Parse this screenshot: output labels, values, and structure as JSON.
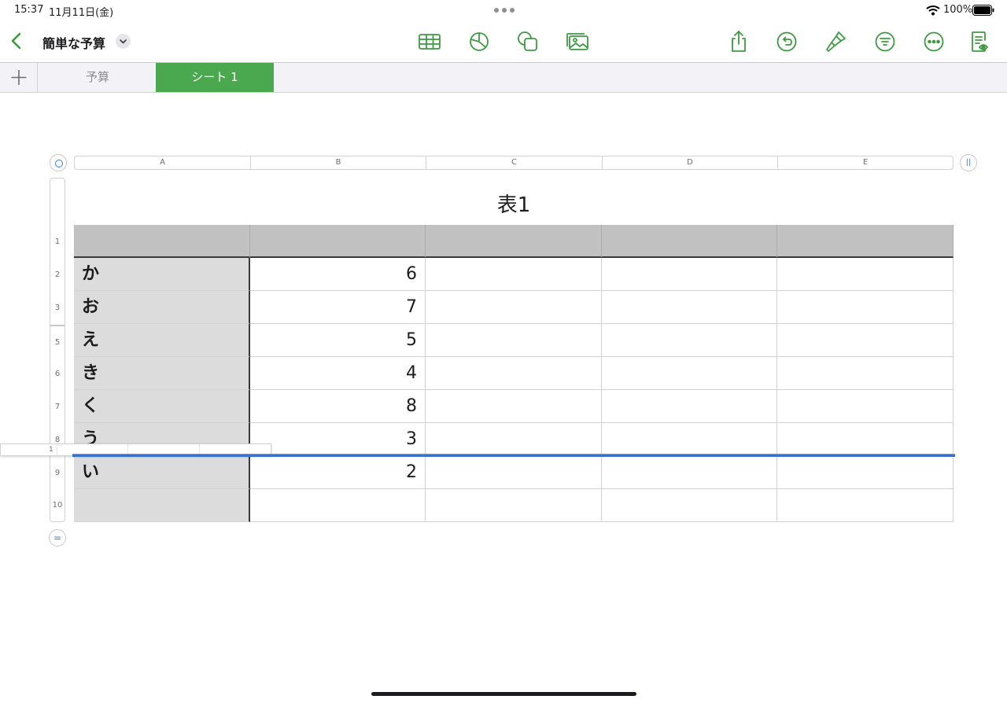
{
  "status_bar": {
    "time": "15:37",
    "date": "11月11日(金)",
    "battery": "100%"
  },
  "toolbar": {
    "doc_title": "簡単な予算",
    "icons": [
      "table-icon",
      "chart-icon",
      "shape-icon",
      "media-icon",
      "share-icon",
      "undo-icon",
      "format-brush-icon",
      "organize-icon",
      "more-icon",
      "reader-view-icon"
    ],
    "accent_color": "#3d9a41"
  },
  "sheets": {
    "tabs": [
      {
        "label": "予算",
        "active": false
      },
      {
        "label": "シート 1",
        "active": true
      }
    ],
    "active_color": "#4aa84f"
  },
  "table": {
    "title": "表1",
    "columns": [
      "A",
      "B",
      "C",
      "D",
      "E"
    ],
    "row_numbers": [
      "1",
      "2",
      "3",
      "5",
      "6",
      "7",
      "8",
      "9",
      "10"
    ],
    "rows": [
      [
        "",
        "",
        "",
        "",
        ""
      ],
      [
        "か",
        "6",
        "",
        "",
        ""
      ],
      [
        "お",
        "7",
        "",
        "",
        ""
      ],
      [
        "え",
        "5",
        "",
        "",
        ""
      ],
      [
        "き",
        "4",
        "",
        "",
        ""
      ],
      [
        "く",
        "8",
        "",
        "",
        ""
      ],
      [
        "う",
        "3",
        "",
        "",
        ""
      ],
      [
        "い",
        "2",
        "",
        "",
        ""
      ],
      [
        "",
        "",
        "",
        "",
        ""
      ]
    ],
    "dragged_row_label": "1",
    "insertion_color": "#3a72c9"
  }
}
